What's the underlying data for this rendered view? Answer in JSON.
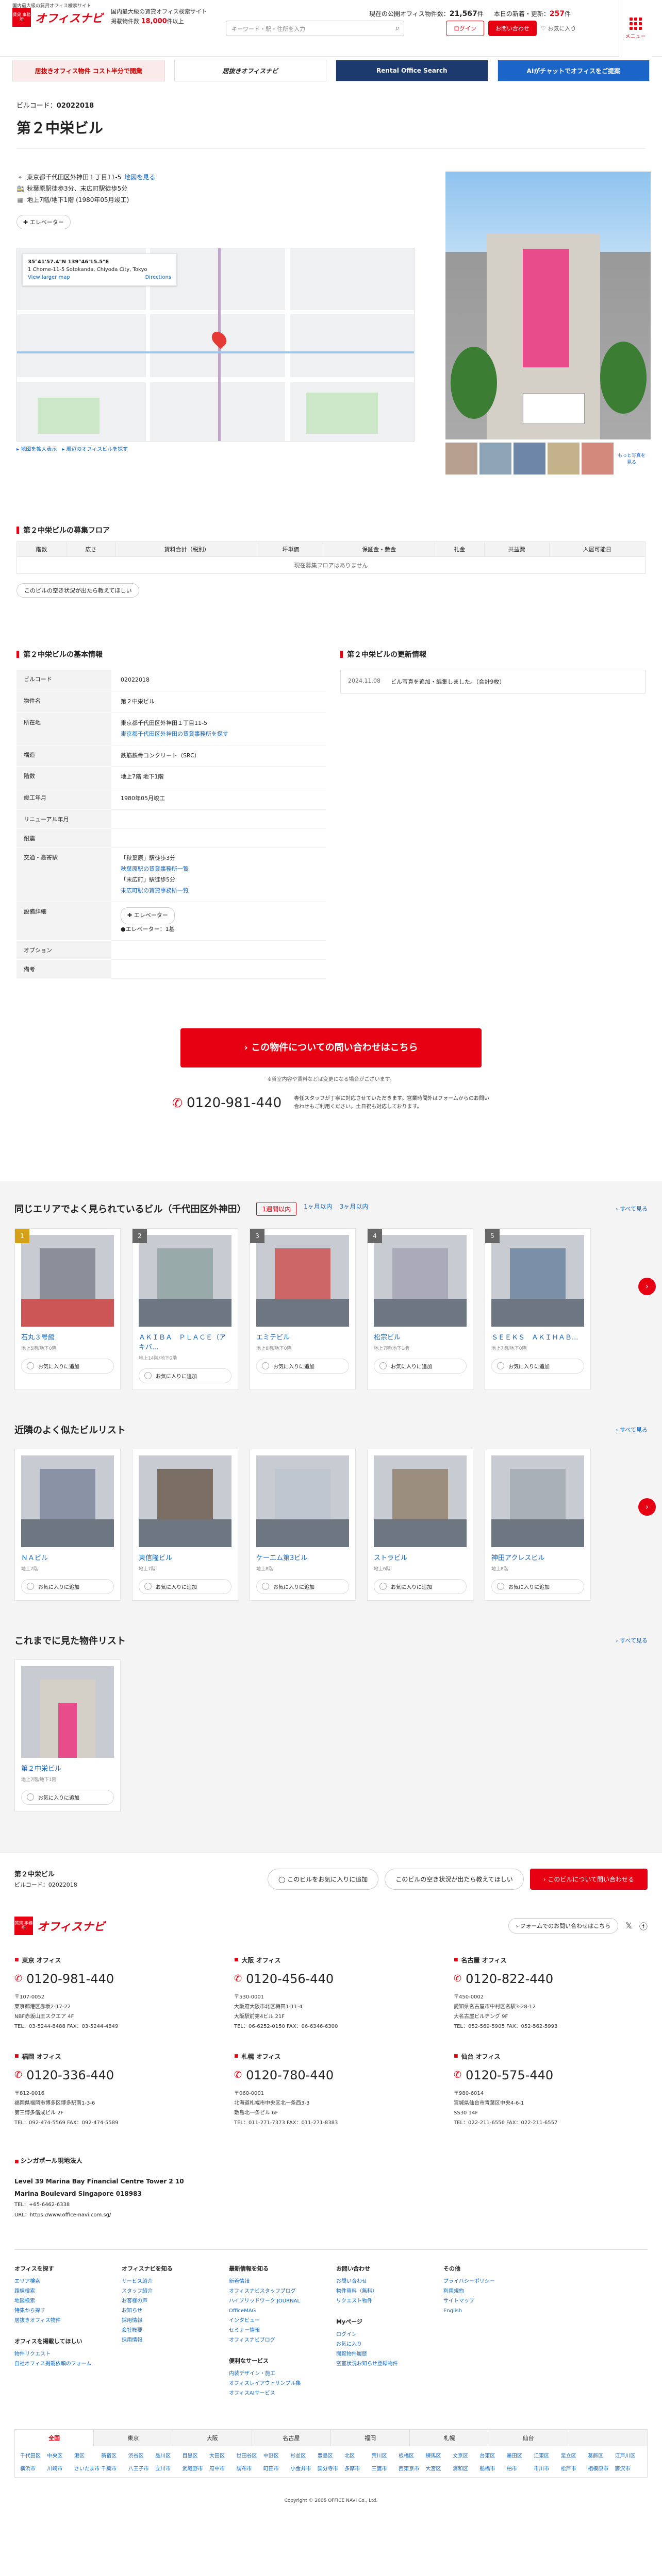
{
  "header": {
    "logo_tag": "国内最大級の賃貸オフィス検索サイト",
    "logo_name": "オフィスナビ",
    "logo_mark": "賃貸 事務所",
    "info_line1": "国内最大級の賃貸オフィス検索サイト",
    "info_line2": "掲載物件数",
    "info_count": "18,000",
    "info_count_suffix": "件以上",
    "search_placeholder": "キーワード・駅・住所を入力",
    "stat1_label": "現在の公開オフィス物件数：",
    "stat1_value": "21,567",
    "stat1_unit": "件",
    "stat2_label": "本日の新着・更新：",
    "stat2_value": "257",
    "stat2_unit": "件",
    "login": "ログイン",
    "contact": "お問い合わせ",
    "favorite": "♡ お気に入り",
    "menu": "メニュー"
  },
  "banners": [
    "居抜きオフィス物件 コスト半分で開業",
    "居抜きオフィスナビ",
    "Rental Office Search",
    "AIがチャットでオフィスをご提案"
  ],
  "property": {
    "code_label": "ビルコード：",
    "code": "02022018",
    "name": "第２中栄ビル",
    "address": "東京都千代田区外神田１丁目11-5",
    "map_link": "地図を見る",
    "station": "秋葉原駅徒歩3分、末広町駅徒歩5分",
    "structure": "地上7階/地下1階 (1980年05月竣工)",
    "tag": "エレベーター",
    "map_card_title": "35°41'57.4\"N 139°46'15.5\"E",
    "map_card_addr": "1 Chome-11-5 Sotokanda, Chiyoda City, Tokyo",
    "map_card_link": "View larger map",
    "map_card_dir": "Directions",
    "map_link1": "地図を拡大表示",
    "map_link2": "周辺のオフィスビルを探す",
    "photo_more": "もっと写真を見る"
  },
  "vacancy": {
    "title": "第２中栄ビルの募集フロア",
    "headers": [
      "階数",
      "広さ",
      "賃料合計（税別）",
      "坪単価",
      "保証金・敷金",
      "礼金",
      "共益費",
      "入居可能日"
    ],
    "empty": "現在募集フロアはありません",
    "notify": "このビルの空き状況が出たら教えてほしい"
  },
  "basic": {
    "title": "第２中栄ビルの基本情報",
    "rows": [
      {
        "k": "ビルコード",
        "v": "02022018"
      },
      {
        "k": "物件名",
        "v": "第２中栄ビル"
      },
      {
        "k": "所在地",
        "v": "東京都千代田区外神田１丁目11-5",
        "link": "東京都千代田区外神田の賃貸事務所を探す"
      },
      {
        "k": "構造",
        "v": "鉄筋鉄骨コンクリート（SRC）"
      },
      {
        "k": "階数",
        "v": "地上7階 地下1階"
      },
      {
        "k": "竣工年月",
        "v": "1980年05月竣工"
      },
      {
        "k": "リニューアル年月",
        "v": ""
      },
      {
        "k": "耐震",
        "v": ""
      },
      {
        "k": "交通・最寄駅",
        "v": "「秋葉原」駅徒歩3分",
        "link": "秋葉原駅の賃貸事務所一覧",
        "v2": "「末広町」駅徒歩5分",
        "link2": "末広町駅の賃貸事務所一覧"
      },
      {
        "k": "設備詳細",
        "v": "エレベーター",
        "v2": "●エレベーター：1基"
      },
      {
        "k": "オプション",
        "v": ""
      },
      {
        "k": "備考",
        "v": ""
      }
    ]
  },
  "update": {
    "title": "第２中栄ビルの更新情報",
    "date": "2024.11.08",
    "text": "ビル写真を追加・編集しました。（合計9枚）"
  },
  "cta": {
    "button": "この物件についての問い合わせはこちら",
    "note": "※貸室内容や賃料などは変更になる場合がございます。",
    "tel": "0120-981-440",
    "desc": "専任スタッフが丁寧に対応させていただきます。営業時間外はフォームからのお問い合わせもご利用ください。土日祝も対応しております。"
  },
  "popular": {
    "title": "同じエリアでよく見られているビル（千代田区外神田）",
    "filters": [
      "1週間以内",
      "1ヶ月以内",
      "3ヶ月以内"
    ],
    "all": "すべて見る",
    "items": [
      {
        "rank": "1",
        "name": "石丸３号館",
        "sub": "地上5階/地下0階"
      },
      {
        "rank": "2",
        "name": "ＡＫＩＢＡ　ＰＬＡＣＥ（アキバ...",
        "sub": "地上14階/地下0階"
      },
      {
        "rank": "3",
        "name": "エミテビル",
        "sub": "地上8階/地下0階"
      },
      {
        "rank": "4",
        "name": "松宗ビル",
        "sub": "地上7階/地下1階"
      },
      {
        "rank": "5",
        "name": "ＳＥＥＫＳ　ＡＫＩＨＡＢ...",
        "sub": "地上7階/地下0階"
      }
    ],
    "fav": "お気に入りに追加"
  },
  "nearby": {
    "title": "近隣のよく似たビルリスト",
    "all": "すべて見る",
    "items": [
      {
        "name": "ＮＡビル",
        "sub": "地上7階"
      },
      {
        "name": "東信隆ビル",
        "sub": "地上7階"
      },
      {
        "name": "ケーエム第3ビル",
        "sub": "地上8階"
      },
      {
        "name": "ストラビル",
        "sub": "地上6階"
      },
      {
        "name": "神田アクレスビル",
        "sub": "地上8階"
      }
    ],
    "fav": "お気に入りに追加"
  },
  "history": {
    "title": "これまでに見た物件リスト",
    "all": "すべて見る",
    "items": [
      {
        "name": "第２中栄ビル",
        "sub": "地上7階/地下1階"
      }
    ],
    "fav": "お気に入りに追加"
  },
  "bottom_bar": {
    "title": "第２中栄ビル",
    "code": "ビルコード：02022018",
    "btn1": "このビルをお気に入りに追加",
    "btn2": "このビルの空き状況が出たら教えてほしい",
    "btn3": "このビルについて問い合わせる"
  },
  "footer": {
    "form": "フォームでのお問い合わせはこちら",
    "offices": [
      {
        "name": "東京 オフィス",
        "tel": "0120-981-440",
        "zip": "〒107-0052",
        "addr": "東京都港区赤坂2-17-22",
        "addr2": "NBF赤坂山王スクエア 4F",
        "fax": "TEL：03-5244-8488 FAX：03-5244-4849"
      },
      {
        "name": "大阪 オフィス",
        "tel": "0120-456-440",
        "zip": "〒530-0001",
        "addr": "大阪府大阪市北区梅田1-11-4",
        "addr2": "大阪駅前第4ビル 21F",
        "fax": "TEL：06-6252-0150 FAX：06-6346-6300"
      },
      {
        "name": "名古屋 オフィス",
        "tel": "0120-822-440",
        "zip": "〒450-0002",
        "addr": "愛知県名古屋市中村区名駅3-28-12",
        "addr2": "大名古屋ビルヂング 9F",
        "fax": "TEL：052-569-5905 FAX：052-562-5993"
      },
      {
        "name": "福岡 オフィス",
        "tel": "0120-336-440",
        "zip": "〒812-0016",
        "addr": "福岡県福岡市博多区博多駅南1-3-6",
        "addr2": "第三博多偕成ビル 2F",
        "fax": "TEL：092-474-5569 FAX：092-474-5589"
      },
      {
        "name": "札幌 オフィス",
        "tel": "0120-780-440",
        "zip": "〒060-0001",
        "addr": "北海道札幌市中央区北一条西3-3",
        "addr2": "敷島北一条ビル 6F",
        "fax": "TEL：011-271-7373 FAX：011-271-8383"
      },
      {
        "name": "仙台 オフィス",
        "tel": "0120-575-440",
        "zip": "〒980-6014",
        "addr": "宮城県仙台市青葉区中央4-6-1",
        "addr2": "SS30 14F",
        "fax": "TEL：022-211-6556 FAX：022-211-6557"
      }
    ],
    "sg_title": "シンガポール現地法人",
    "sg_addr1": "Level 39 Marina Bay Financial Centre Tower 2 10",
    "sg_addr2": "Marina Boulevard Singapore 018983",
    "sg_tel": "TEL：+65-6462-6338",
    "sg_url": "URL：https://www.office-navi.com.sg/",
    "nav": [
      {
        "h": "オフィスを探す",
        "links": [
          "エリア検索",
          "路線検索",
          "地図検索",
          "特集から探す",
          "居抜きオフィス物件"
        ],
        "h2": "オフィスを掲載してほしい",
        "links2": [
          "物件リクエスト",
          "自社オフィス掲載依頼のフォーム"
        ]
      },
      {
        "h": "オフィスナビを知る",
        "links": [
          "サービス紹介",
          "スタッフ紹介",
          "お客様の声",
          "お知らせ",
          "採用情報",
          "会社概要",
          "採用情報"
        ]
      },
      {
        "h": "最新情報を知る",
        "links": [
          "新着情報",
          "オフィスナビスタッフブログ",
          "ハイブリッドワーク JOURNAL",
          "OfficeMAG",
          "インタビュー",
          "セミナー情報",
          "オフィスナビブログ"
        ],
        "h2": "便利なサービス",
        "links2": [
          "内装デザイン・施工",
          "オフィスレイアウトサンプル集",
          "オフィスAIサービス"
        ]
      },
      {
        "h": "お問い合わせ",
        "links": [
          "お問い合わせ",
          "物件資料（無料）",
          "リクエスト物件"
        ],
        "h2": "Myページ",
        "links2": [
          "ログイン",
          "お気に入り",
          "閲覧物件履歴",
          "空室状況お知らせ登録物件"
        ]
      },
      {
        "h": "その他",
        "links": [
          "プライバシーポリシー",
          "利用規約",
          "サイトマップ",
          "English"
        ]
      }
    ],
    "area_tabs": [
      "全国",
      "東京",
      "大阪",
      "名古屋",
      "福岡",
      "札幌",
      "仙台"
    ],
    "wards": [
      "千代田区",
      "中央区",
      "港区",
      "新宿区",
      "渋谷区",
      "品川区",
      "目黒区",
      "大田区",
      "世田谷区",
      "中野区",
      "杉並区",
      "豊島区",
      "北区",
      "荒川区",
      "板橋区",
      "練馬区",
      "文京区",
      "台東区",
      "墨田区",
      "江東区",
      "足立区",
      "葛飾区",
      "江戸川区",
      "横浜市",
      "川崎市",
      "さいたま市",
      "千葉市",
      "八王子市",
      "立川市",
      "武蔵野市",
      "府中市",
      "調布市",
      "町田市",
      "小金井市",
      "国分寺市",
      "多摩市",
      "三鷹市",
      "西東京市",
      "大宮区",
      "浦和区",
      "船橋市",
      "柏市",
      "市川市",
      "松戸市",
      "相模原市",
      "藤沢市"
    ],
    "copyright": "Copyright © 2005 OFFICE NAVI Co., Ltd."
  }
}
